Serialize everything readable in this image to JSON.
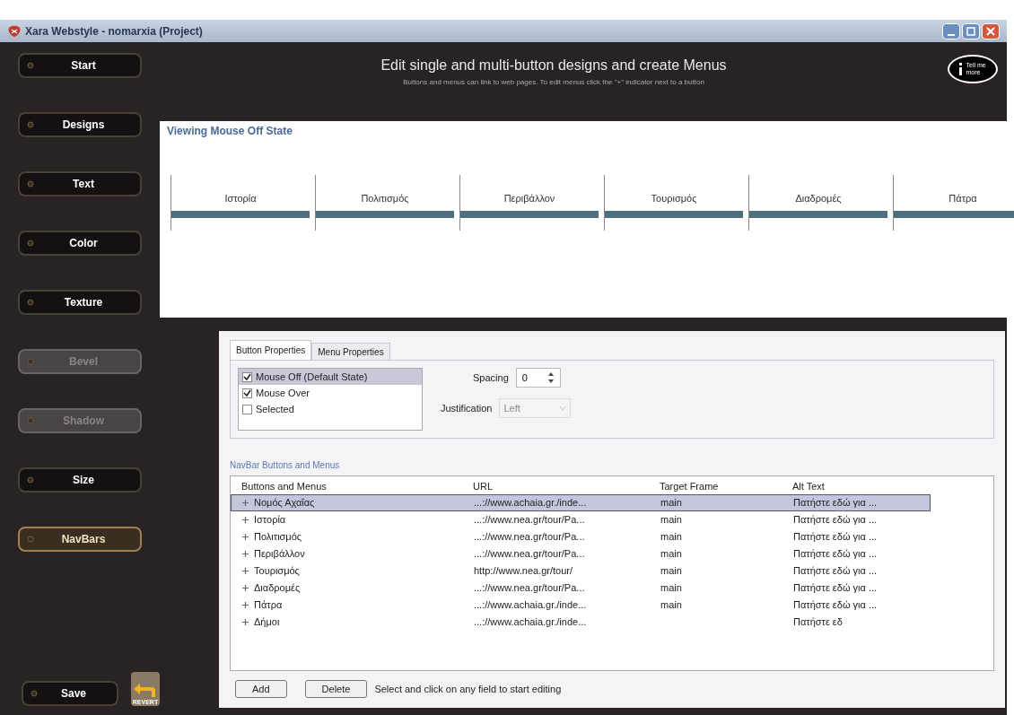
{
  "window": {
    "title": "Xara Webstyle - nomarxia (Project)"
  },
  "sidebar": {
    "items": [
      {
        "label": "Start",
        "disabled": false,
        "selected": false
      },
      {
        "label": "Designs",
        "disabled": false,
        "selected": false
      },
      {
        "label": "Text",
        "disabled": false,
        "selected": false
      },
      {
        "label": "Color",
        "disabled": false,
        "selected": false
      },
      {
        "label": "Texture",
        "disabled": false,
        "selected": false
      },
      {
        "label": "Bevel",
        "disabled": true,
        "selected": false
      },
      {
        "label": "Shadow",
        "disabled": true,
        "selected": false
      },
      {
        "label": "Size",
        "disabled": false,
        "selected": false
      },
      {
        "label": "NavBars",
        "disabled": false,
        "selected": true
      }
    ],
    "save": "Save",
    "revert": "REVERT"
  },
  "header": {
    "title": "Edit single and multi-button designs and create Menus",
    "subtitle": "Buttons and menus can link to web pages. To edit menus click the \"+\" indicator next to a button",
    "help": "Tell me more"
  },
  "preview": {
    "caption": "Viewing Mouse Off State",
    "buttons": [
      "Ιστορία",
      "Πολιτισμός",
      "Περιβάλλον",
      "Τουρισμός",
      "Διαδρομές",
      "Πάτρα"
    ]
  },
  "dialog": {
    "tabs": [
      {
        "label": "Button Properties",
        "selected": true
      },
      {
        "label": "Menu Properties",
        "selected": false
      }
    ],
    "states": [
      {
        "label": "Mouse Off (Default State)",
        "checked": true,
        "selected": true
      },
      {
        "label": "Mouse Over",
        "checked": true,
        "selected": false
      },
      {
        "label": "Selected",
        "checked": false,
        "selected": false
      }
    ],
    "spacing": {
      "label": "Spacing",
      "value": "0"
    },
    "justification": {
      "label": "Justification",
      "value": "Left",
      "disabled": true
    },
    "group_title": "NavBar Buttons and Menus",
    "table": {
      "columns": [
        "Buttons and Menus",
        "URL",
        "Target Frame",
        "Alt Text"
      ],
      "rows": [
        {
          "selected": true,
          "cells": [
            "Νομός Αχαΐας",
            "...://www.achaia.gr./inde...",
            "main",
            "Πατήστε εδώ για ..."
          ]
        },
        {
          "selected": false,
          "cells": [
            "Ιστορία",
            "...://www.nea.gr/tour/Pa...",
            "main",
            "Πατήστε εδώ για ..."
          ]
        },
        {
          "selected": false,
          "cells": [
            "Πολιτισμός",
            "...://www.nea.gr/tour/Pa...",
            "main",
            "Πατήστε εδώ για ..."
          ]
        },
        {
          "selected": false,
          "cells": [
            "Περιβάλλον",
            "...://www.nea.gr/tour/Pa...",
            "main",
            "Πατήστε εδώ για ..."
          ]
        },
        {
          "selected": false,
          "cells": [
            "Τουρισμός",
            "http://www.nea.gr/tour/",
            "main",
            "Πατήστε εδώ για ..."
          ]
        },
        {
          "selected": false,
          "cells": [
            "Διαδρομές",
            "...://www.nea.gr/tour/Pa...",
            "main",
            "Πατήστε εδώ για ..."
          ]
        },
        {
          "selected": false,
          "cells": [
            "Πάτρα",
            "...://www.achaia.gr./inde...",
            "main",
            "Πατήστε εδώ για ..."
          ]
        },
        {
          "selected": false,
          "cells": [
            "Δήμοι",
            "...://www.achaia.gr./inde...",
            "",
            "Πατήστε εδ"
          ]
        }
      ]
    },
    "buttons": [
      "Add",
      "Delete"
    ],
    "hint": "Select and click on any field to start editing"
  }
}
